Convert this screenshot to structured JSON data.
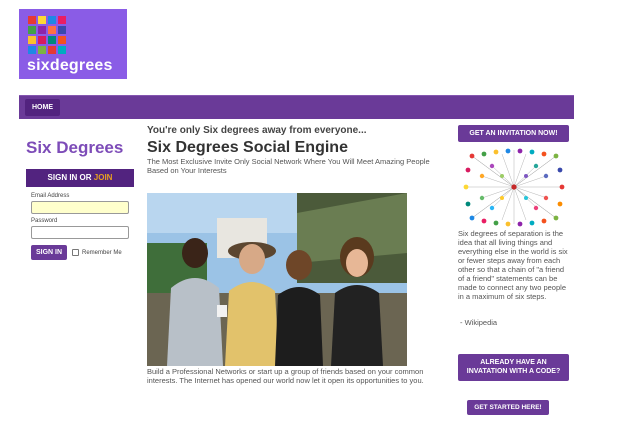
{
  "logo": {
    "text": "sixdegrees"
  },
  "nav": {
    "home": "HOME"
  },
  "sidebar": {
    "title": "Six Degrees",
    "signin_prefix": "SIGN IN OR ",
    "join": "JOIN",
    "email_label": "Email Address",
    "email_value": "",
    "password_label": "Password",
    "password_value": "",
    "signin_button": "SIGN IN",
    "remember_label": "Remember Me"
  },
  "main": {
    "tagline": "You're only Six degrees away from everyone...",
    "title": "Six Degrees Social Engine",
    "subtitle": "The Most Exclusive Invite Only Social Network Where You Will Meet Amazing People Based on Your Interests",
    "body": "Build a Professional Networks or start up a group of friends based on your common interests. The Internet has opened our world now let it open its opportunities to you."
  },
  "right": {
    "invite_button": "GET AN INVITATION NOW!",
    "quote": "Six degrees of separation is the idea that all living things and everything else in the world is six or fewer steps away from each other so that a chain of \"a friend of a friend\" statements can be made to connect any two people in a maximum of six steps.",
    "attribution": "- Wikipedia",
    "code_button_line1": "ALREADY HAVE AN",
    "code_button_line2": "INVATATION WITH A CODE?",
    "start_button": "GET STARTED HERE!"
  },
  "colors": {
    "logo_bg": "#8a5ce6",
    "nav": "#6a3a98",
    "accent_dark": "#52237f",
    "title_purple": "#7d4cb8",
    "join_orange": "#e6a020"
  }
}
